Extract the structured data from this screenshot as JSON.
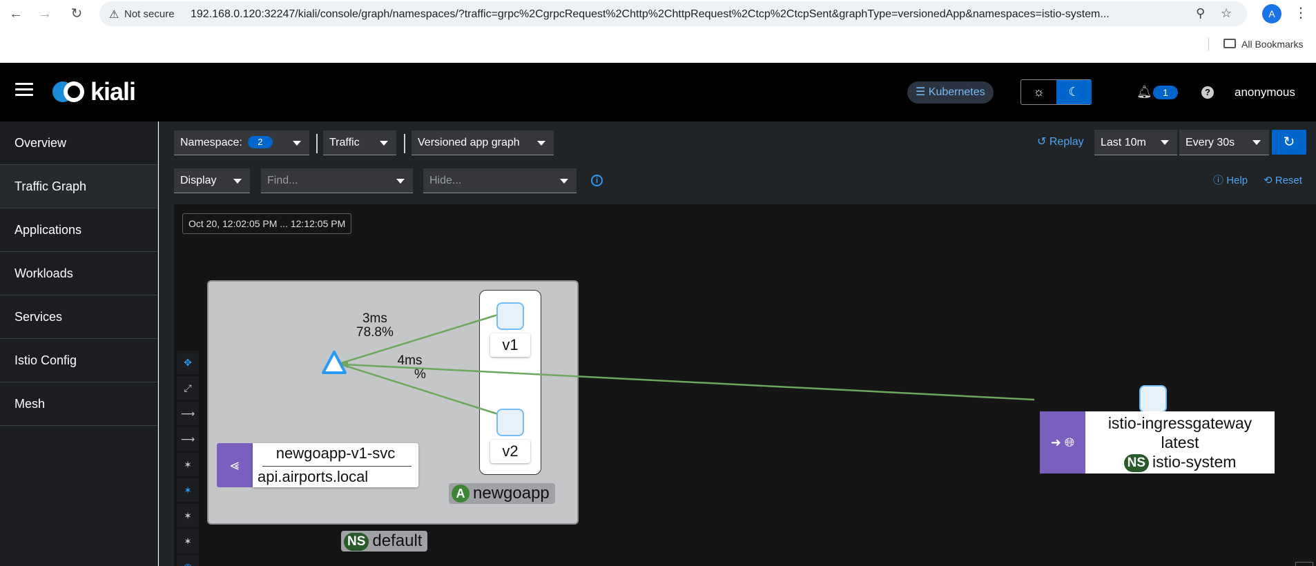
{
  "browser": {
    "security_label": "Not secure",
    "url": "192.168.0.120:32247/kiali/console/graph/namespaces/?traffic=grpc%2CgrpcRequest%2Chttp%2ChttpRequest%2Ctcp%2CtcpSent&graphType=versionedApp&namespaces=istio-system...",
    "profile_initial": "A",
    "bookmarks_label": "All Bookmarks"
  },
  "masthead": {
    "logo_text": "kiali",
    "cluster_label": "Kubernetes",
    "notification_count": "1",
    "help_icon": "?",
    "user": "anonymous"
  },
  "sidebar": {
    "items": [
      {
        "label": "Overview"
      },
      {
        "label": "Traffic Graph"
      },
      {
        "label": "Applications"
      },
      {
        "label": "Workloads"
      },
      {
        "label": "Services"
      },
      {
        "label": "Istio Config"
      },
      {
        "label": "Mesh"
      }
    ]
  },
  "toolbar": {
    "namespace_label": "Namespace:",
    "namespace_count": "2",
    "traffic_label": "Traffic",
    "graph_type_label": "Versioned app graph",
    "display_label": "Display",
    "find_placeholder": "Find...",
    "hide_placeholder": "Hide...",
    "info_icon": "i",
    "replay_label": "Replay",
    "duration_value": "Last 10m",
    "refresh_interval_value": "Every 30s",
    "help_label": "Help",
    "reset_label": "Reset"
  },
  "graph": {
    "time_range": "Oct 20, 12:02:05 PM ... 12:12:05 PM",
    "namespace_box": {
      "tag": "NS",
      "name": "default"
    },
    "app_box": {
      "tag": "A",
      "name": "newgoapp"
    },
    "versions": [
      "v1",
      "v2"
    ],
    "edges": [
      {
        "rt": "3ms",
        "pct": "78.8%"
      },
      {
        "rt": "4ms",
        "pct": "%"
      }
    ],
    "service_node": {
      "name": "newgoapp-v1-svc",
      "host": "api.airports.local"
    },
    "gateway_node": {
      "name": "istio-ingressgateway",
      "version": "latest",
      "ns_tag": "NS",
      "namespace": "istio-system"
    },
    "colors": {
      "edge": "#6ca85c",
      "node_border": "#73bcf7",
      "service_purple": "#7a5fbf",
      "accent": "#0066cc"
    }
  }
}
